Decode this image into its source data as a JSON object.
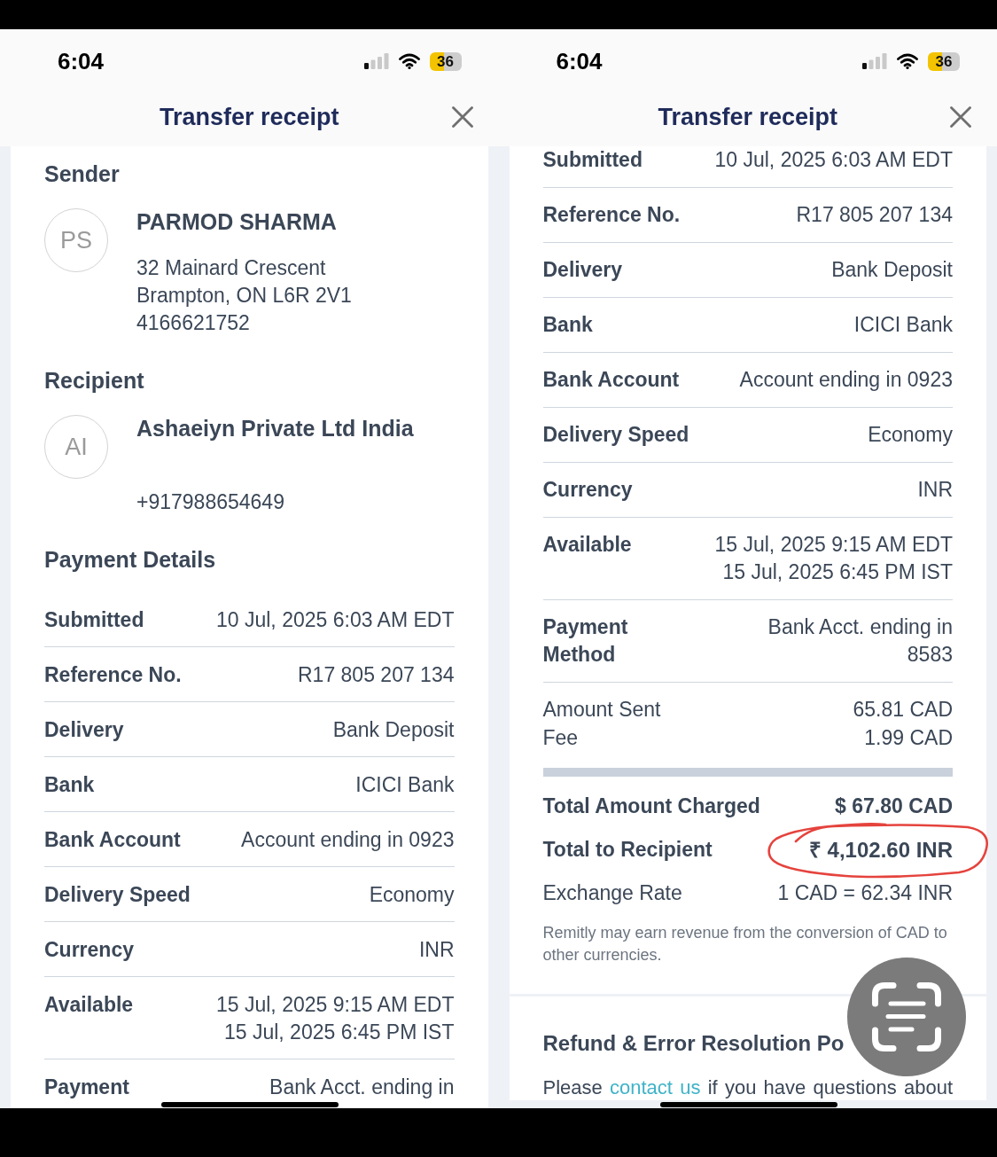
{
  "screens": [
    {
      "status_bar": {
        "time": "6:04",
        "battery": "36"
      },
      "header": {
        "title": "Transfer receipt"
      },
      "scan_button": false,
      "cards": [
        {
          "blocks": [
            {
              "kind": "heading",
              "text": "Sender"
            },
            {
              "kind": "party",
              "initials": "PS",
              "name": "PARMOD SHARMA",
              "address": [
                "32 Mainard Crescent",
                "Brampton, ON L6R 2V1"
              ],
              "phone": "4166621752"
            },
            {
              "kind": "heading",
              "text": "Recipient"
            },
            {
              "kind": "party",
              "initials": "AI",
              "name": "Ashaeiyn Private Ltd India",
              "phone": "+917988654649"
            },
            {
              "kind": "heading",
              "text": "Payment Details"
            },
            {
              "kind": "row",
              "label": "Submitted",
              "values": [
                "10 Jul, 2025 6:03 AM EDT"
              ]
            },
            {
              "kind": "row",
              "label": "Reference No.",
              "values": [
                "R17 805 207 134"
              ]
            },
            {
              "kind": "row",
              "label": "Delivery",
              "values": [
                "Bank Deposit"
              ]
            },
            {
              "kind": "row",
              "label": "Bank",
              "values": [
                "ICICI Bank"
              ]
            },
            {
              "kind": "row",
              "label": "Bank Account",
              "values": [
                "Account ending in 0923"
              ]
            },
            {
              "kind": "row",
              "label": "Delivery Speed",
              "values": [
                "Economy"
              ]
            },
            {
              "kind": "row",
              "label": "Currency",
              "values": [
                "INR"
              ]
            },
            {
              "kind": "row",
              "label": "Available",
              "values": [
                "15 Jul, 2025 9:15 AM EDT",
                "15 Jul, 2025 6:45 PM IST"
              ]
            },
            {
              "kind": "row",
              "label": "Payment",
              "values": [
                "Bank Acct. ending in"
              ]
            }
          ]
        }
      ]
    },
    {
      "status_bar": {
        "time": "6:04",
        "battery": "36"
      },
      "header": {
        "title": "Transfer receipt"
      },
      "scan_button": true,
      "cards": [
        {
          "blocks": [
            {
              "kind": "row",
              "label": "Submitted",
              "values": [
                "10 Jul, 2025 6:03 AM EDT"
              ]
            },
            {
              "kind": "row",
              "label": "Reference No.",
              "values": [
                "R17 805 207 134"
              ]
            },
            {
              "kind": "row",
              "label": "Delivery",
              "values": [
                "Bank Deposit"
              ]
            },
            {
              "kind": "row",
              "label": "Bank",
              "values": [
                "ICICI Bank"
              ]
            },
            {
              "kind": "row",
              "label": "Bank Account",
              "values": [
                "Account ending in 0923"
              ]
            },
            {
              "kind": "row",
              "label": "Delivery Speed",
              "values": [
                "Economy"
              ]
            },
            {
              "kind": "row",
              "label": "Currency",
              "values": [
                "INR"
              ]
            },
            {
              "kind": "row",
              "label": "Available",
              "values": [
                "15 Jul, 2025 9:15 AM EDT",
                "15 Jul, 2025 6:45 PM IST"
              ]
            },
            {
              "kind": "row",
              "label": "Payment Method",
              "values": [
                "Bank Acct. ending in",
                "8583"
              ]
            },
            {
              "kind": "breakdown",
              "items": [
                {
                  "label": "Amount Sent",
                  "value": "65.81 CAD"
                },
                {
                  "label": "Fee",
                  "value": "1.99 CAD"
                }
              ]
            },
            {
              "kind": "summary",
              "items": [
                {
                  "kind": "total",
                  "label": "Total Amount Charged",
                  "value": "$ 67.80 CAD",
                  "circled": false
                },
                {
                  "kind": "grand_total",
                  "label": "Total to Recipient",
                  "value": "₹ 4,102.60 INR",
                  "circled": true
                },
                {
                  "kind": "rate",
                  "label": "Exchange Rate",
                  "value": "1 CAD = 62.34 INR",
                  "circled": false
                }
              ]
            },
            {
              "kind": "note",
              "text": "Remitly may earn revenue from the conversion of CAD to other currencies."
            }
          ]
        },
        {
          "blocks": [
            {
              "kind": "policy",
              "heading": "Refund & Error Resolution Po",
              "paragraph": {
                "before": "Please",
                "link": "contact us",
                "after": "if you have questions about"
              }
            }
          ]
        }
      ]
    }
  ]
}
